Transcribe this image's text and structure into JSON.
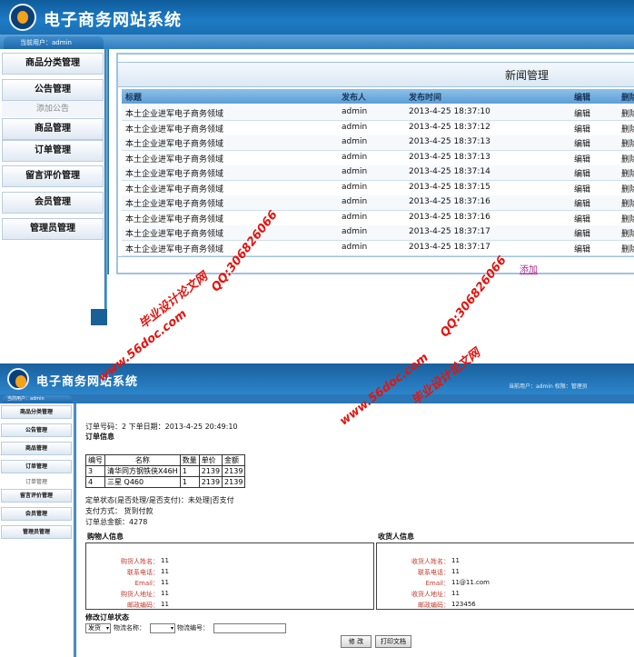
{
  "app": {
    "title": "电子商务网站系统"
  },
  "panel1": {
    "user_tab": "当前用户：admin",
    "sidebar": [
      {
        "label": "商品分类管理"
      },
      {
        "label": "公告管理"
      },
      {
        "label": "添加公告",
        "sub": true
      },
      {
        "label": "商品管理"
      },
      {
        "label": "订单管理"
      },
      {
        "label": "留言评价管理"
      },
      {
        "label": "会员管理"
      },
      {
        "label": "管理员管理"
      }
    ],
    "heading": "新闻管理",
    "columns": [
      "标题",
      "发布人",
      "发布时间",
      "编辑",
      "删除"
    ],
    "rows": [
      {
        "title": "本土企业进军电子商务领域",
        "author": "admin",
        "time": "2013-4-25 18:37:10",
        "edit": "编辑",
        "del": "删除"
      },
      {
        "title": "本土企业进军电子商务领域",
        "author": "admin",
        "time": "2013-4-25 18:37:12",
        "edit": "编辑",
        "del": "删除"
      },
      {
        "title": "本土企业进军电子商务领域",
        "author": "admin",
        "time": "2013-4-25 18:37:13",
        "edit": "编辑",
        "del": "删除"
      },
      {
        "title": "本土企业进军电子商务领域",
        "author": "admin",
        "time": "2013-4-25 18:37:13",
        "edit": "编辑",
        "del": "删除"
      },
      {
        "title": "本土企业进军电子商务领域",
        "author": "admin",
        "time": "2013-4-25 18:37:14",
        "edit": "编辑",
        "del": "删除"
      },
      {
        "title": "本土企业进军电子商务领域",
        "author": "admin",
        "time": "2013-4-25 18:37:15",
        "edit": "编辑",
        "del": "删除"
      },
      {
        "title": "本土企业进军电子商务领域",
        "author": "admin",
        "time": "2013-4-25 18:37:16",
        "edit": "编辑",
        "del": "删除"
      },
      {
        "title": "本土企业进军电子商务领域",
        "author": "admin",
        "time": "2013-4-25 18:37:16",
        "edit": "编辑",
        "del": "删除"
      },
      {
        "title": "本土企业进军电子商务领域",
        "author": "admin",
        "time": "2013-4-25 18:37:17",
        "edit": "编辑",
        "del": "删除"
      },
      {
        "title": "本土企业进军电子商务领域",
        "author": "admin",
        "time": "2013-4-25 18:37:17",
        "edit": "编辑",
        "del": "删除"
      }
    ],
    "add_link": "添加"
  },
  "panel2": {
    "user_tab": "当前用户：admin",
    "top_info": "当前用户：admin    权限：管理员",
    "sidebar": [
      {
        "label": "商品分类管理"
      },
      {
        "label": "公告管理"
      },
      {
        "label": "商品管理"
      },
      {
        "label": "订单管理"
      },
      {
        "label": "订单管理",
        "sub": true
      },
      {
        "label": "留言评价管理"
      },
      {
        "label": "会员管理"
      },
      {
        "label": "管理员管理"
      }
    ],
    "order_line": "订单号码：2  下单日期：2013-4-25 20:49:10",
    "order_info_title": "订单信息",
    "item_columns": [
      "编号",
      "名称",
      "数量",
      "单价",
      "金额"
    ],
    "items": [
      {
        "id": "3",
        "name": "清华同方钢铁侠X46H",
        "qty": "1",
        "price": "2139",
        "amount": "2139"
      },
      {
        "id": "4",
        "name": "三星 Q460",
        "qty": "1",
        "price": "2139",
        "amount": "2139"
      }
    ],
    "status_line": "定单状态(是否处理/是否支付)：未处理|否支付",
    "pay_line": "支付方式：  货到付款",
    "total_line": "订单总金额：4278",
    "buyer": {
      "title": "购物人信息",
      "fields": [
        {
          "label": "购货人姓名：",
          "value": "11"
        },
        {
          "label": "联系电话：",
          "value": "11"
        },
        {
          "label": "Email：",
          "value": "11"
        },
        {
          "label": "购货人地址：",
          "value": "11"
        },
        {
          "label": "邮政编码：",
          "value": "11"
        }
      ]
    },
    "receiver": {
      "title": "收货人信息",
      "fields": [
        {
          "label": "收货人姓名：",
          "value": "11"
        },
        {
          "label": "联系电话：",
          "value": "11"
        },
        {
          "label": "Email：",
          "value": "11@11.com"
        },
        {
          "label": "收货人地址：",
          "value": "11"
        },
        {
          "label": "邮政编码：",
          "value": "123456"
        }
      ]
    },
    "modify_title": "修改订单状态",
    "status_select": "发货",
    "logistics_name_label": "物流名称：",
    "logistics_no_label": "物流编号：",
    "modify_button": "修 改",
    "print_button": "打印文档"
  },
  "watermarks": {
    "qq": "QQ:306826066",
    "site": "www.56doc.com",
    "brand": "毕业设计论文网"
  }
}
